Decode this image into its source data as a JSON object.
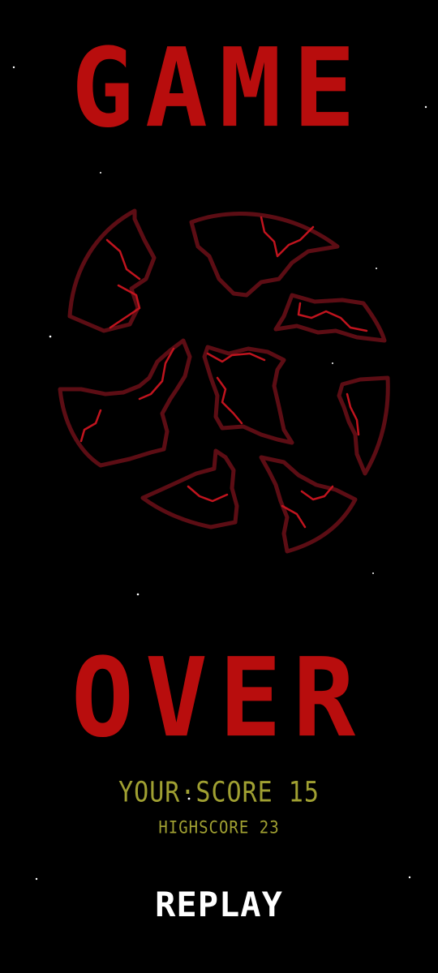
{
  "title": {
    "line1": "GAME",
    "line2": "OVER"
  },
  "score": {
    "your_score_label": "YOUR·SCORE 15",
    "highscore_label": "HIGHSCORE 23"
  },
  "actions": {
    "replay_label": "REPLAY"
  },
  "colors": {
    "title": "#b80d0d",
    "planet_outline": "#5c0d14",
    "planet_veins": "#c0141e",
    "score_text": "#a0a032",
    "replay_text": "#ffffff",
    "background": "#000000"
  },
  "icons": {
    "planet": "shattered-planet-icon",
    "stars": "star-icon"
  }
}
